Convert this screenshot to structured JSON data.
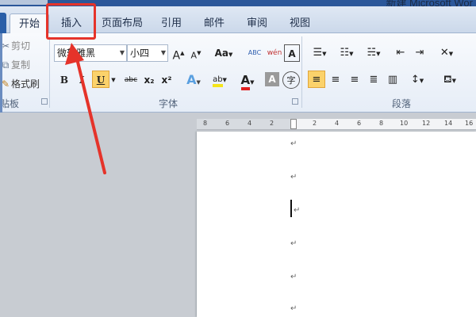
{
  "window": {
    "title": "新建 Microsoft Wor"
  },
  "tabs": [
    {
      "label": "开始",
      "active": true
    },
    {
      "label": "插入",
      "active": false
    },
    {
      "label": "页面布局",
      "active": false
    },
    {
      "label": "引用",
      "active": false
    },
    {
      "label": "邮件",
      "active": false
    },
    {
      "label": "审阅",
      "active": false
    },
    {
      "label": "视图",
      "active": false
    }
  ],
  "clipboard": {
    "cut": "剪切",
    "copy": "复制",
    "format_painter": "格式刷",
    "group_label": "贴板"
  },
  "font": {
    "name": "微软雅黑",
    "size": "小四",
    "grow": "A",
    "shrink": "A",
    "change_case": "Aa",
    "clear_format": "ABC",
    "phonetic": "wén",
    "char_border": "A",
    "bold": "B",
    "italic": "I",
    "underline": "U",
    "strikethrough": "abc",
    "subscript": "x₂",
    "superscript": "x²",
    "text_effect": "A",
    "highlight": "ab",
    "font_color": "A",
    "char_shading": "A",
    "enclose": "字",
    "group_label": "字体"
  },
  "paragraph": {
    "group_label": "段落"
  },
  "ruler": {
    "numbers": [
      "8",
      "6",
      "4",
      "2",
      "",
      "2",
      "4",
      "6",
      "8",
      "10",
      "12",
      "14",
      "16"
    ]
  },
  "document": {
    "para_mark": "↵"
  },
  "colors": {
    "accent": "#2b579a",
    "annotation": "#e5332a",
    "highlight_yellow": "#fbd26b",
    "font_red": "#e02020"
  }
}
